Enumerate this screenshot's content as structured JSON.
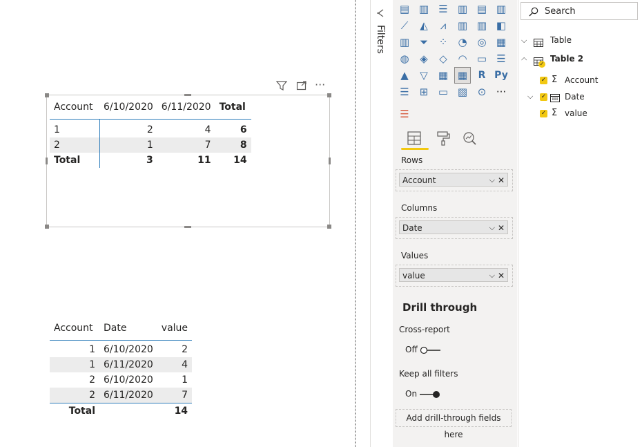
{
  "canvas": {
    "matrix": {
      "headers": [
        "Account",
        "6/10/2020",
        "6/11/2020",
        "Total"
      ],
      "rows": [
        {
          "account": "1",
          "v1": "2",
          "v2": "4",
          "total": "6"
        },
        {
          "account": "2",
          "v1": "1",
          "v2": "7",
          "total": "8"
        }
      ],
      "total_row": {
        "label": "Total",
        "v1": "3",
        "v2": "11",
        "total": "14"
      }
    },
    "table": {
      "headers": [
        "Account",
        "Date",
        "value"
      ],
      "rows": [
        {
          "account": "1",
          "date": "6/10/2020",
          "value": "2"
        },
        {
          "account": "1",
          "date": "6/11/2020",
          "value": "4"
        },
        {
          "account": "2",
          "date": "6/10/2020",
          "value": "1"
        },
        {
          "account": "2",
          "date": "6/11/2020",
          "value": "7"
        }
      ],
      "total_row": {
        "label": "Total",
        "value": "14"
      }
    },
    "visual_header_icons": [
      "filter-icon",
      "focus-mode-icon",
      "more-options-icon"
    ]
  },
  "filters": {
    "label": "Filters",
    "icon": "collapse-arrow-icon"
  },
  "visualizations": {
    "r_label": "R",
    "py_label": "Py",
    "ellipsis": "···",
    "tabs": [
      "fields-tab-icon",
      "format-tab-icon",
      "analytics-tab-icon"
    ],
    "wells": {
      "rows": {
        "label": "Rows",
        "field": "Account"
      },
      "columns": {
        "label": "Columns",
        "field": "Date"
      },
      "values": {
        "label": "Values",
        "field": "value"
      }
    },
    "drill": {
      "title": "Drill through",
      "cross_report_label": "Cross-report",
      "cross_report_state": "Off",
      "keep_filters_label": "Keep all filters",
      "keep_filters_state": "On",
      "add_fields": "Add drill-through fields here"
    },
    "accent": "#f2c811"
  },
  "fields": {
    "search_placeholder": "Search",
    "tables": [
      {
        "name": "Table"
      },
      {
        "name": "Table 2",
        "fields": [
          "Account",
          "Date",
          "value"
        ]
      }
    ]
  }
}
